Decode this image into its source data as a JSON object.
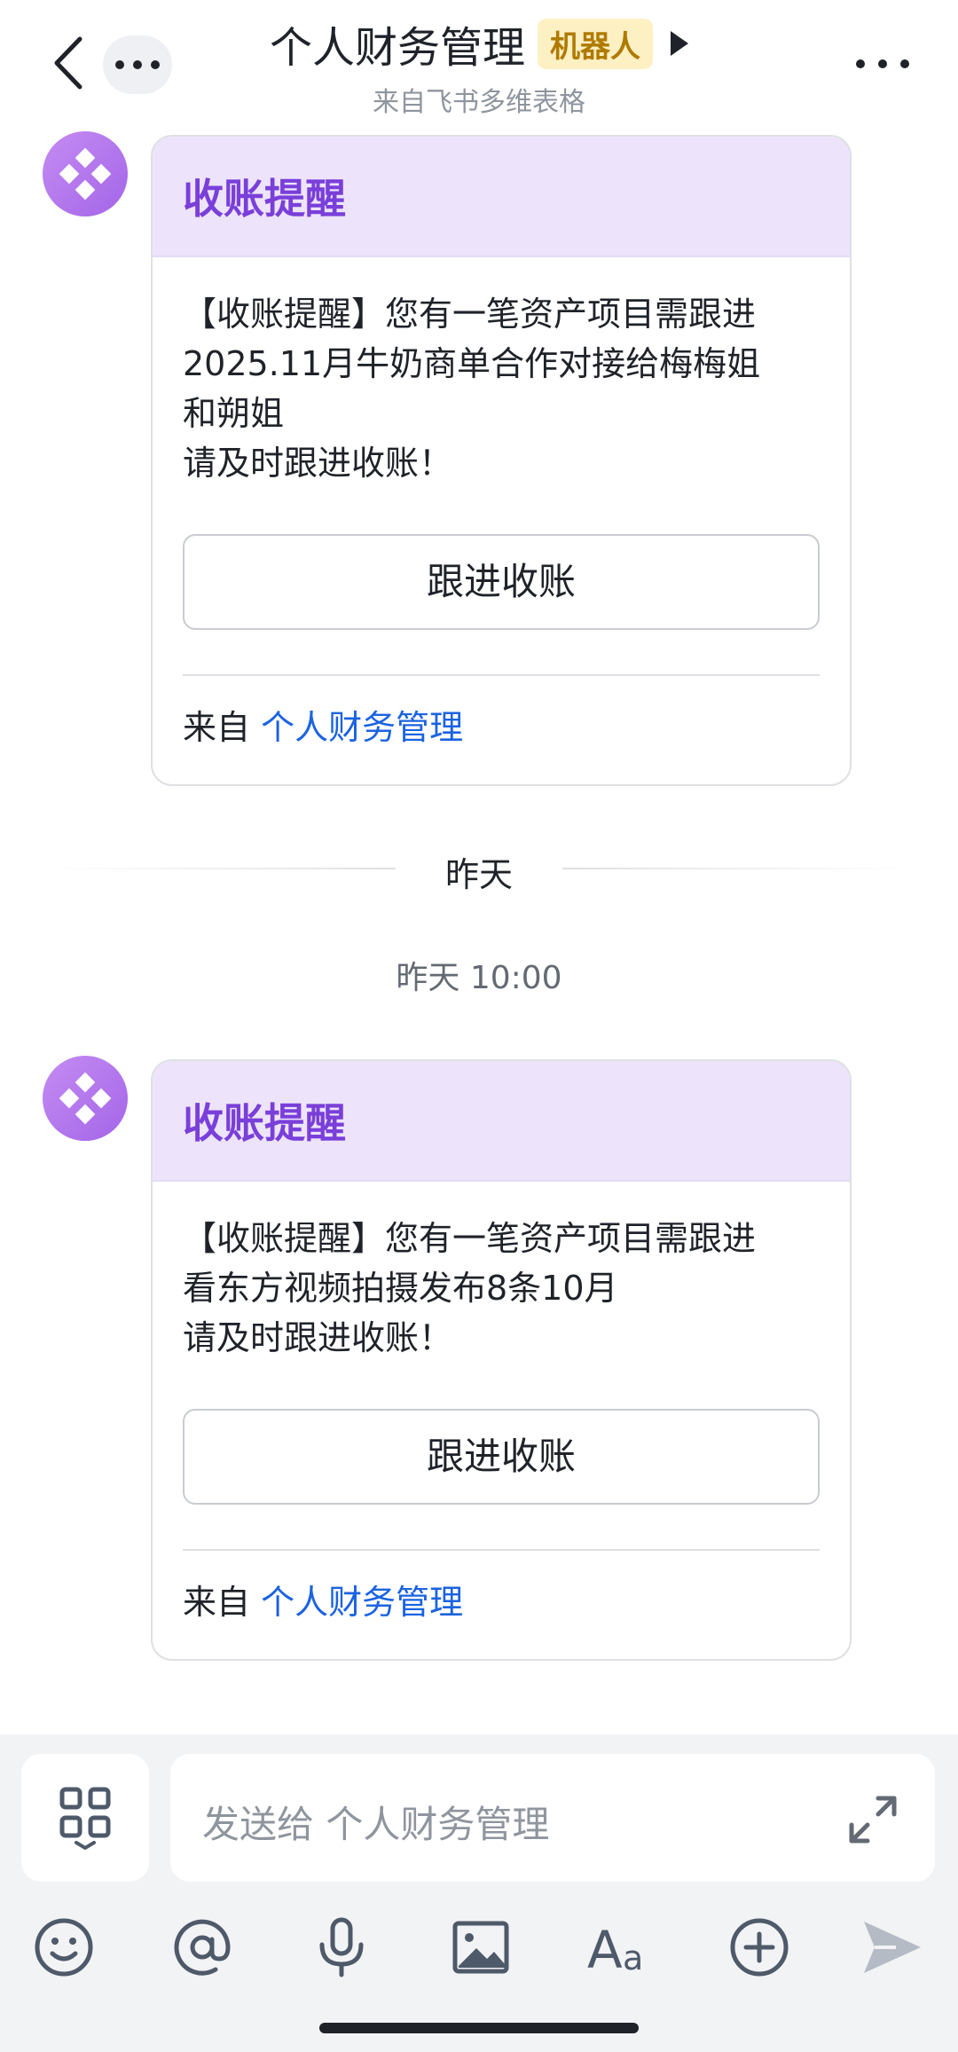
{
  "header": {
    "title": "个人财务管理",
    "badge": "机器人",
    "subtitle": "来自飞书多维表格"
  },
  "messages": [
    {
      "card_title": "收账提醒",
      "body_lines": [
        "【收账提醒】您有一笔资产项目需跟进",
        "2025.11月牛奶商单合作对接给梅梅姐",
        "和朔姐",
        "请及时跟进收账！"
      ],
      "button_label": "跟进收账",
      "from_prefix": "来自",
      "from_link": "个人财务管理"
    },
    {
      "card_title": "收账提醒",
      "body_lines": [
        "【收账提醒】您有一笔资产项目需跟进",
        "看东方视频拍摄发布8条10月",
        "请及时跟进收账！"
      ],
      "button_label": "跟进收账",
      "from_prefix": "来自",
      "from_link": "个人财务管理"
    }
  ],
  "day_divider": "昨天",
  "timestamp": "昨天 10:00",
  "composer": {
    "placeholder": "发送给 个人财务管理"
  },
  "icons": [
    "back-icon",
    "more-icon",
    "play-icon",
    "apps-icon",
    "expand-icon",
    "emoji-icon",
    "mention-icon",
    "mic-icon",
    "image-icon",
    "font-icon",
    "plus-icon",
    "send-icon"
  ],
  "colors": {
    "accent_purple": "#7a3fd9",
    "card_header_bg": "#ede4fb",
    "link_blue": "#1b63e0",
    "badge_bg": "#fdf0c3",
    "badge_text": "#b07a00"
  }
}
